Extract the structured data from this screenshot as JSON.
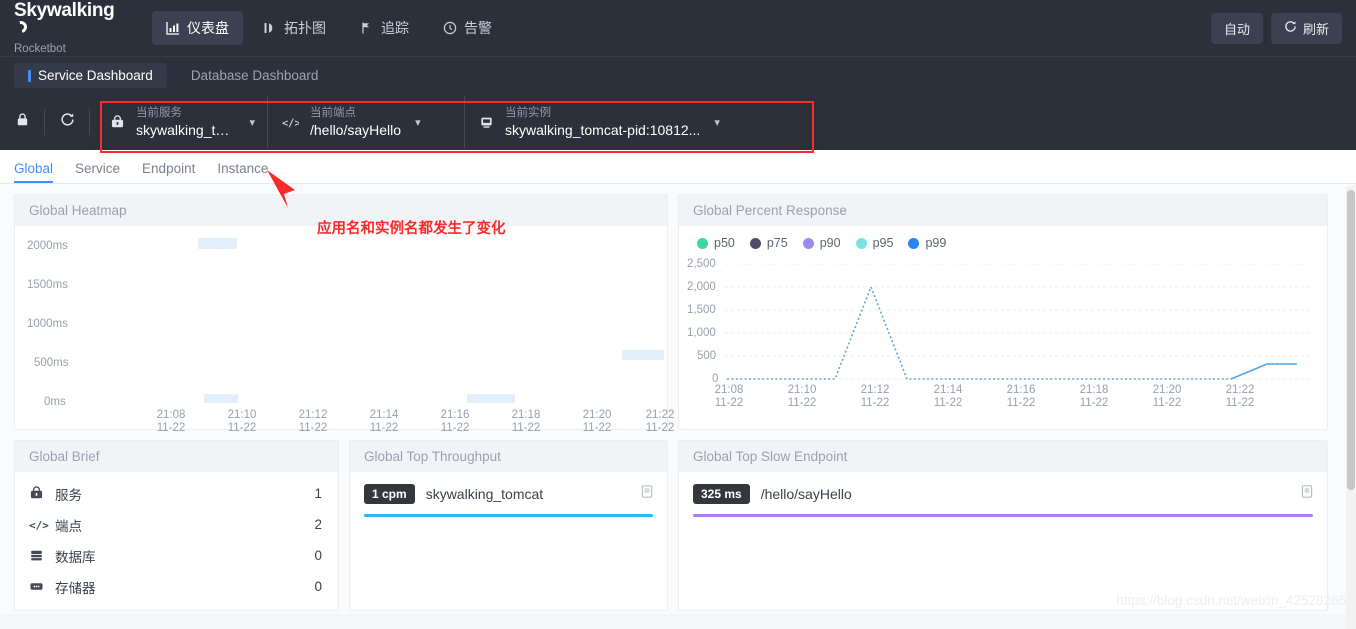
{
  "brand": {
    "name": "Skywalking",
    "sub": "Rocketbot"
  },
  "topnav": {
    "items": [
      {
        "label": "仪表盘",
        "icon": "dashboard-icon",
        "active": true
      },
      {
        "label": "拓扑图",
        "icon": "topology-icon",
        "active": false
      },
      {
        "label": "追踪",
        "icon": "trace-icon",
        "active": false
      },
      {
        "label": "告警",
        "icon": "alarm-icon",
        "active": false
      }
    ],
    "auto_label": "自动",
    "refresh_label": "刷新"
  },
  "dashboard_tabs": [
    {
      "label": "Service Dashboard",
      "active": true
    },
    {
      "label": "Database Dashboard",
      "active": false
    }
  ],
  "selector_bar": {
    "lock_icon": "lock-icon",
    "reload_icon": "reload-icon",
    "selectors": [
      {
        "label": "当前服务",
        "value": "skywalking_tomcat",
        "icon": "service-icon"
      },
      {
        "label": "当前端点",
        "value": "/hello/sayHello",
        "icon": "endpoint-icon"
      },
      {
        "label": "当前实例",
        "value": "skywalking_tomcat-pid:10812...",
        "icon": "instance-icon"
      }
    ]
  },
  "sub_tabs": [
    {
      "label": "Global",
      "active": true
    },
    {
      "label": "Service",
      "active": false
    },
    {
      "label": "Endpoint",
      "active": false
    },
    {
      "label": "Instance",
      "active": false
    }
  ],
  "annotation": {
    "text": "应用名和实例名都发生了变化",
    "color": "#fb2b2b"
  },
  "panels": {
    "heatmap_title": "Global Heatmap",
    "percent_title": "Global Percent Response",
    "brief_title": "Global Brief",
    "throughput_title": "Global Top Throughput",
    "slow_title": "Global Top Slow Endpoint"
  },
  "brief": {
    "rows": [
      {
        "icon": "service-icon",
        "name": "服务",
        "value": "1"
      },
      {
        "icon": "endpoint-icon",
        "name": "端点",
        "value": "2"
      },
      {
        "icon": "database-icon",
        "name": "数据库",
        "value": "0"
      },
      {
        "icon": "cache-icon",
        "name": "存储器",
        "value": "0"
      }
    ]
  },
  "top_throughput": {
    "badge": "1 cpm",
    "name": "skywalking_tomcat",
    "bar_color": "#29b6f6",
    "bar_percent": 100,
    "copy_icon": "copy-icon"
  },
  "top_slow": {
    "badge": "325 ms",
    "name": "/hello/sayHello",
    "bar_color": "#ab7df6",
    "bar_percent": 100,
    "copy_icon": "copy-icon"
  },
  "watermark": "https://blog.csdn.net/weixin_42528266",
  "chart_data": [
    {
      "type": "heatmap",
      "title": "Global Heatmap",
      "xlabel": "",
      "ylabel": "",
      "ylim": [
        0,
        2000
      ],
      "yticks": [
        "0ms",
        "500ms",
        "1000ms",
        "1500ms",
        "2000ms"
      ],
      "x": [
        "21:08\n11-22",
        "21:10\n11-22",
        "21:12\n11-22",
        "21:14\n11-22",
        "21:16\n11-22",
        "21:18\n11-22",
        "21:20\n11-22",
        "21:22\n11-22"
      ],
      "xtick_times": [
        "21:08",
        "21:10",
        "21:12",
        "21:14",
        "21:16",
        "21:18",
        "21:20",
        "21:22"
      ],
      "xtick_dates": [
        "11-22",
        "11-22",
        "11-22",
        "11-22",
        "11-22",
        "11-22",
        "11-22",
        "11-22"
      ],
      "cells": [
        {
          "x_index": 1,
          "y_ms": 2000,
          "value": 1
        },
        {
          "x_index": 1,
          "y_ms": 0,
          "value": 1
        },
        {
          "x_index": 5,
          "y_ms": 0,
          "value": 1
        },
        {
          "x_index": 6,
          "y_ms": 500,
          "value": 1
        }
      ],
      "grid": false
    },
    {
      "type": "line",
      "title": "Global Percent Response",
      "xlabel": "",
      "ylabel": "",
      "ylim": [
        0,
        2500
      ],
      "yticks": [
        "0",
        "500",
        "1,000",
        "1,500",
        "2,000",
        "2,500"
      ],
      "xtick_times": [
        "21:08",
        "21:10",
        "21:12",
        "21:14",
        "21:16",
        "21:18",
        "21:20",
        "21:22"
      ],
      "xtick_dates": [
        "11-22",
        "11-22",
        "11-22",
        "11-22",
        "11-22",
        "11-22",
        "11-22",
        "11-22"
      ],
      "legend": [
        {
          "name": "p50",
          "color": "#3fd4a0"
        },
        {
          "name": "p75",
          "color": "#4a4f66"
        },
        {
          "name": "p90",
          "color": "#9b8cf0"
        },
        {
          "name": "p95",
          "color": "#79e3e3"
        },
        {
          "name": "p99",
          "color": "#2b84f0"
        }
      ],
      "legend_position": "top-left",
      "grid": true,
      "series": [
        {
          "name": "p99",
          "color": "#5aa9dd",
          "x": [
            "21:08",
            "21:09",
            "21:10",
            "21:11",
            "21:12",
            "21:13",
            "21:14",
            "21:15",
            "21:16",
            "21:17",
            "21:18",
            "21:19",
            "21:20",
            "21:21",
            "21:22",
            "21:23"
          ],
          "values": [
            0,
            0,
            0,
            2000,
            0,
            0,
            0,
            0,
            0,
            0,
            0,
            0,
            0,
            0,
            0,
            325
          ]
        }
      ]
    }
  ]
}
